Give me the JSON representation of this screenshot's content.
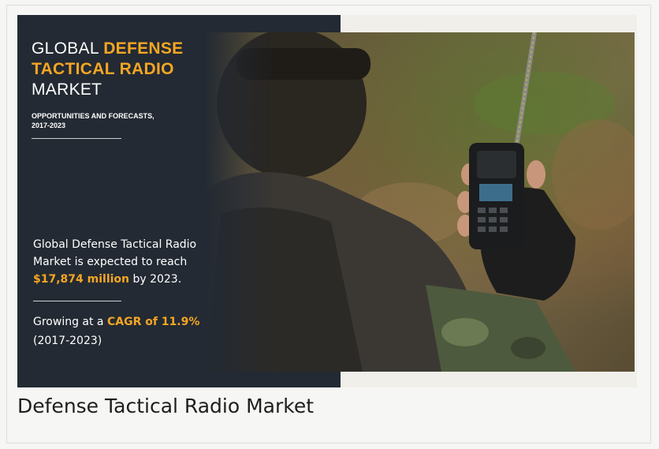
{
  "infographic": {
    "headline_part1": "GLOBAL ",
    "headline_accent": "DEFENSE TACTICAL RADIO",
    "headline_part2": "MARKET",
    "subline_line1": "OPPORTUNITIES AND FORECASTS,",
    "subline_line2": "2017-2023",
    "stat1_text": "Global Defense Tactical Radio Market is expected to reach",
    "stat1_value": "$17,874 million",
    "stat1_suffix": " by 2023.",
    "stat2_prefix": "Growing at a ",
    "stat2_value": "CAGR of 11.9%",
    "stat2_period": "(2017-2023)",
    "accent_color": "#f5a623",
    "panel_color": "#232a33"
  },
  "caption": "Defense Tactical Radio Market"
}
